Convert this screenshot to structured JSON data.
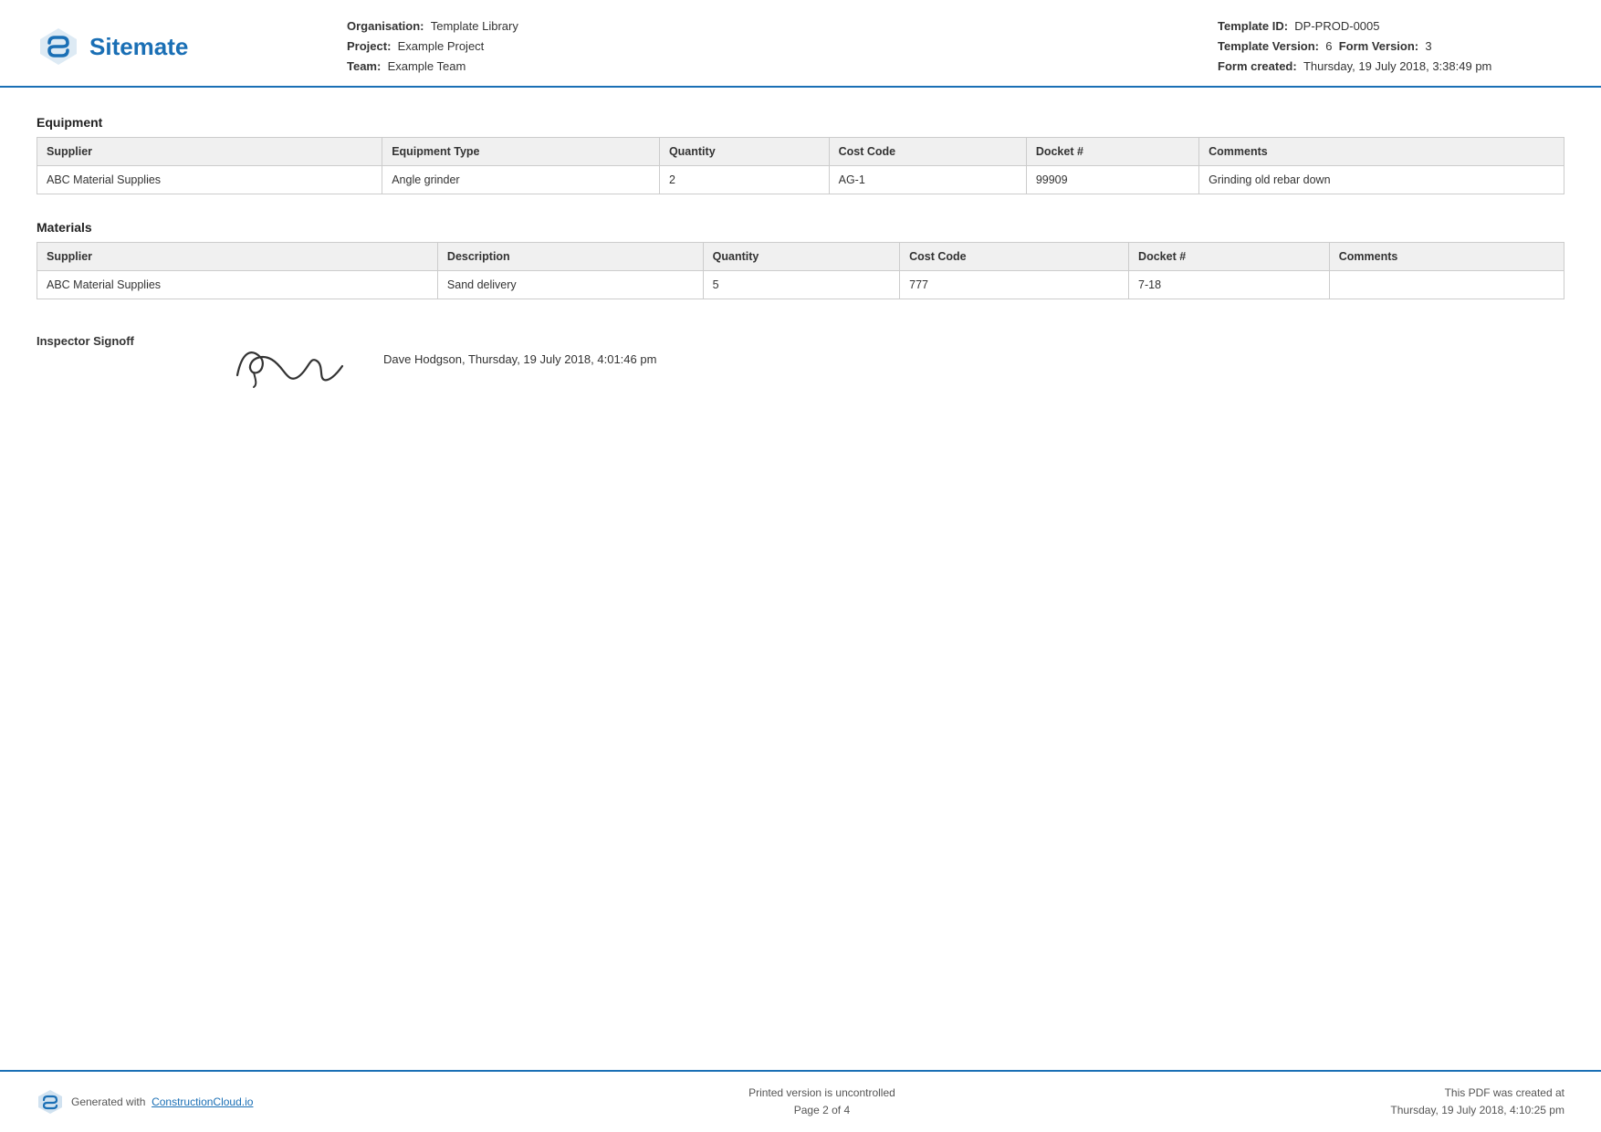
{
  "header": {
    "logo_text": "Sitemate",
    "org_label": "Organisation:",
    "org_value": "Template Library",
    "project_label": "Project:",
    "project_value": "Example Project",
    "team_label": "Team:",
    "team_value": "Example Team",
    "template_id_label": "Template ID:",
    "template_id_value": "DP-PROD-0005",
    "template_version_label": "Template Version:",
    "template_version_value": "6",
    "form_version_label": "Form Version:",
    "form_version_value": "3",
    "form_created_label": "Form created:",
    "form_created_value": "Thursday, 19 July 2018, 3:38:49 pm"
  },
  "equipment_section": {
    "title": "Equipment",
    "columns": [
      "Supplier",
      "Equipment Type",
      "Quantity",
      "Cost Code",
      "Docket #",
      "Comments"
    ],
    "rows": [
      {
        "supplier": "ABC Material Supplies",
        "equipment_type": "Angle grinder",
        "quantity": "2",
        "cost_code": "AG-1",
        "docket": "99909",
        "comments": "Grinding old rebar down"
      }
    ]
  },
  "materials_section": {
    "title": "Materials",
    "columns": [
      "Supplier",
      "Description",
      "Quantity",
      "Cost Code",
      "Docket #",
      "Comments"
    ],
    "rows": [
      {
        "supplier": "ABC Material Supplies",
        "description": "Sand delivery",
        "quantity": "5",
        "cost_code": "777",
        "docket": "7-18",
        "comments": ""
      }
    ]
  },
  "signoff": {
    "label": "Inspector Signoff",
    "info": "Dave Hodgson, Thursday, 19 July 2018, 4:01:46 pm"
  },
  "footer": {
    "generated_text": "Generated with",
    "link_text": "ConstructionCloud.io",
    "center_line1": "Printed version is uncontrolled",
    "center_line2": "Page 2 of 4",
    "right_line1": "This PDF was created at",
    "right_line2": "Thursday, 19 July 2018, 4:10:25 pm"
  }
}
